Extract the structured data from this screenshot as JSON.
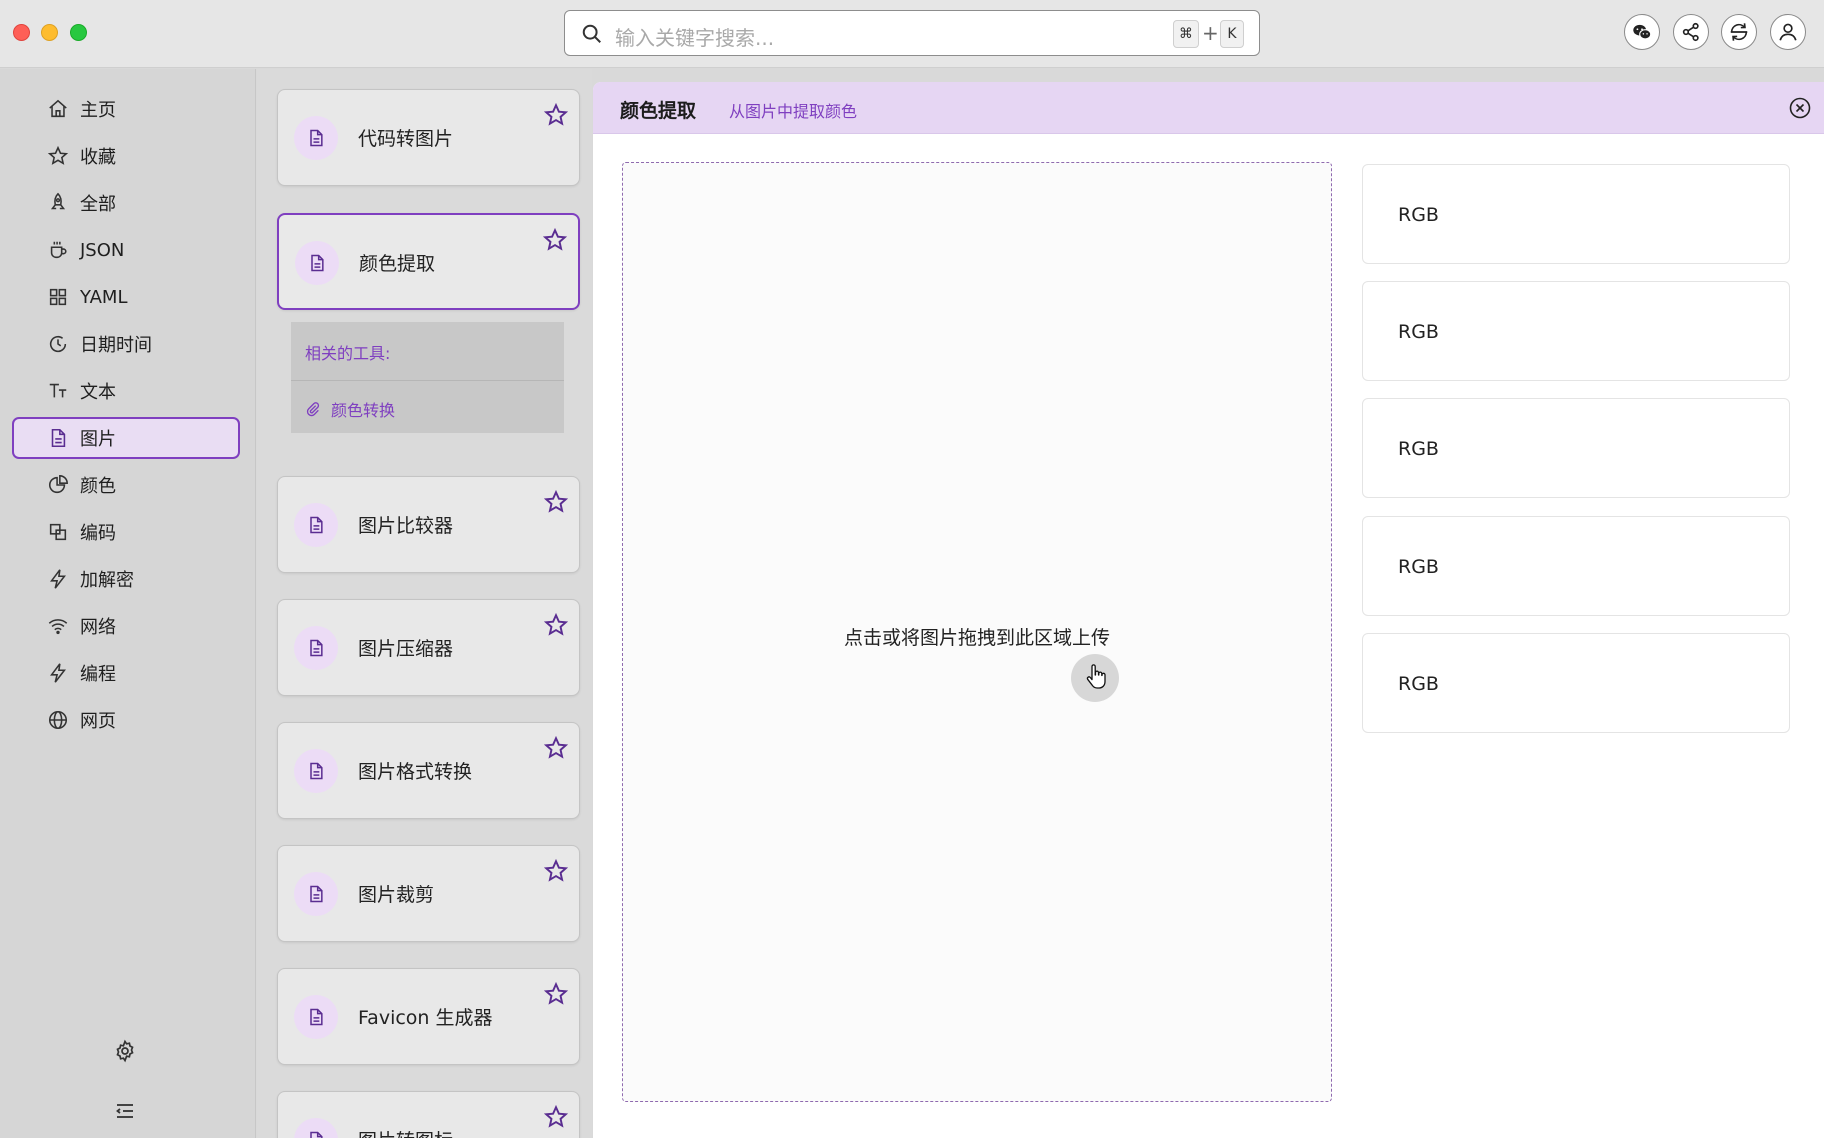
{
  "search": {
    "placeholder": "输入关键字搜索...",
    "shortcut_cmd": "⌘",
    "shortcut_plus": "+",
    "shortcut_key": "K"
  },
  "header_buttons": [
    "wechat-icon",
    "share-icon",
    "cycle-icon",
    "user-icon"
  ],
  "sidebar": {
    "items": [
      {
        "label": "主页",
        "icon": "home-icon",
        "active": false
      },
      {
        "label": "收藏",
        "icon": "star-icon",
        "active": false
      },
      {
        "label": "全部",
        "icon": "rocket-icon",
        "active": false
      },
      {
        "label": "JSON",
        "icon": "cup-icon",
        "active": false
      },
      {
        "label": "YAML",
        "icon": "grid-icon",
        "active": false
      },
      {
        "label": "日期时间",
        "icon": "clock-icon",
        "active": false
      },
      {
        "label": "文本",
        "icon": "text-icon",
        "active": false
      },
      {
        "label": "图片",
        "icon": "image-file-icon",
        "active": true
      },
      {
        "label": "颜色",
        "icon": "pie-icon",
        "active": false
      },
      {
        "label": "编码",
        "icon": "copy-icon",
        "active": false
      },
      {
        "label": "加解密",
        "icon": "bolt-icon",
        "active": false
      },
      {
        "label": "网络",
        "icon": "wifi-icon",
        "active": false
      },
      {
        "label": "编程",
        "icon": "bolt-icon",
        "active": false
      },
      {
        "label": "网页",
        "icon": "globe-icon",
        "active": false
      }
    ],
    "footer_icons": [
      "settings-icon",
      "menu-collapse-icon"
    ]
  },
  "tools": [
    {
      "label": "代码转图片",
      "active": false
    },
    {
      "label": "颜色提取",
      "active": true
    },
    {
      "label": "图片比较器",
      "active": false
    },
    {
      "label": "图片压缩器",
      "active": false
    },
    {
      "label": "图片格式转换",
      "active": false
    },
    {
      "label": "图片裁剪",
      "active": false
    },
    {
      "label": "Favicon 生成器",
      "active": false
    },
    {
      "label": "图片转图标",
      "active": false
    }
  ],
  "related": {
    "title": "相关的工具:",
    "items": [
      "颜色转换"
    ]
  },
  "main": {
    "title": "颜色提取",
    "subtitle": "从图片中提取颜色",
    "dropzone_text": "点击或将图片拖拽到此区域上传",
    "rgb_boxes": [
      "RGB",
      "RGB",
      "RGB",
      "RGB",
      "RGB"
    ]
  },
  "colors": {
    "accent": "#7f3fc0",
    "header_bg": "#e6d6f3",
    "icon_bg": "#ecdcf6"
  }
}
